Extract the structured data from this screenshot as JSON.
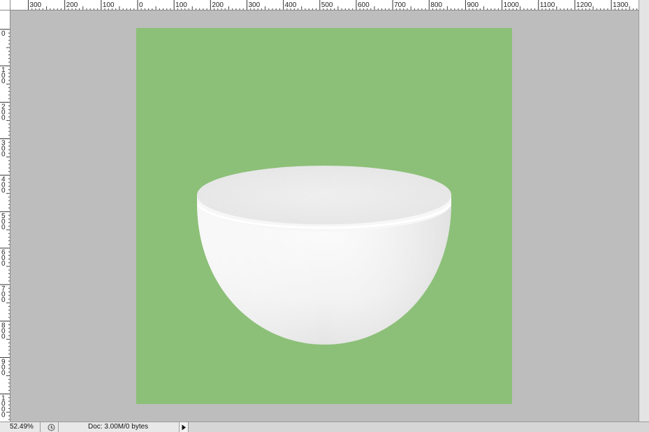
{
  "window": {
    "zoom_level": "52.49%",
    "doc_info": "Doc: 3.00M/0 bytes"
  },
  "rulers": {
    "top_labels": [
      "300",
      "200",
      "100",
      "0",
      "100",
      "200",
      "300",
      "400",
      "500",
      "600",
      "700",
      "800",
      "900",
      "1000",
      "1100",
      "1200",
      "1300"
    ],
    "left_labels": [
      "0",
      "100",
      "200",
      "300",
      "400",
      "500",
      "600",
      "700",
      "800",
      "900",
      "1000"
    ]
  },
  "canvas": {
    "background_color": "#8cc078",
    "object": "bowl"
  },
  "icons": {
    "status_icon": "history-clock-icon",
    "status_menu_icon": "play-triangle-icon"
  }
}
